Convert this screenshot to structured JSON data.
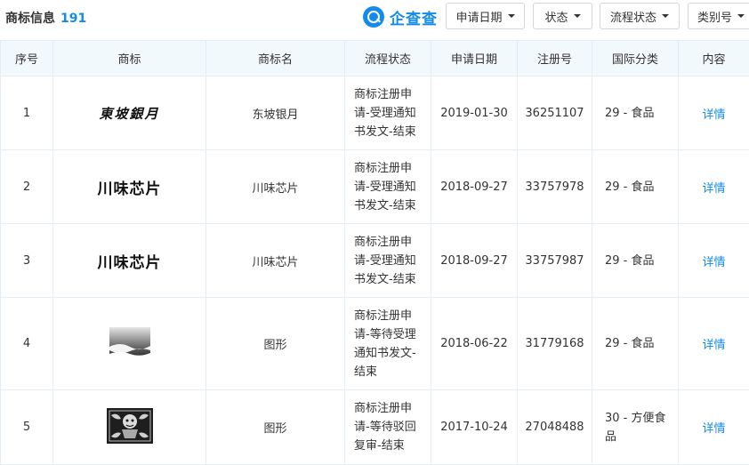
{
  "header": {
    "title": "商标信息",
    "count": "191",
    "logo_text": "企查查",
    "filters": [
      {
        "label": "申请日期"
      },
      {
        "label": "状态"
      },
      {
        "label": "流程状态"
      },
      {
        "label": "类别号"
      }
    ]
  },
  "table": {
    "columns": [
      "序号",
      "商标",
      "商标名",
      "流程状态",
      "申请日期",
      "注册号",
      "国际分类",
      "内容"
    ],
    "rows": [
      {
        "index": "1",
        "logo_text": "東坡銀月",
        "name": "东坡银月",
        "flow": [
          "商标注册申",
          "请-受理通知",
          "书发文-结束"
        ],
        "date": "2019-01-30",
        "reg_no": "36251107",
        "class": [
          "29 - 食品"
        ],
        "detail": "详情"
      },
      {
        "index": "2",
        "logo_text": "川味芯片",
        "name": "川味芯片",
        "flow": [
          "商标注册申",
          "请-受理通知",
          "书发文-结束"
        ],
        "date": "2018-09-27",
        "reg_no": "33757978",
        "class": [
          "29 - 食品"
        ],
        "detail": "详情"
      },
      {
        "index": "3",
        "logo_text": "川味芯片",
        "name": "川味芯片",
        "flow": [
          "商标注册申",
          "请-受理通知",
          "书发文-结束"
        ],
        "date": "2018-09-27",
        "reg_no": "33757987",
        "class": [
          "29 - 食品"
        ],
        "detail": "详情"
      },
      {
        "index": "4",
        "logo_text": "",
        "name": "图形",
        "flow": [
          "商标注册申",
          "请-等待受理",
          "通知书发文-",
          "结束"
        ],
        "date": "2018-06-22",
        "reg_no": "31779168",
        "class": [
          "29 - 食品"
        ],
        "detail": "详情"
      },
      {
        "index": "5",
        "logo_text": "",
        "name": "图形",
        "flow": [
          "商标注册申",
          "请-等待驳回",
          "复审-结束"
        ],
        "date": "2017-10-24",
        "reg_no": "27048488",
        "class": [
          "30 - 方便食",
          "品"
        ],
        "detail": "详情"
      }
    ]
  }
}
